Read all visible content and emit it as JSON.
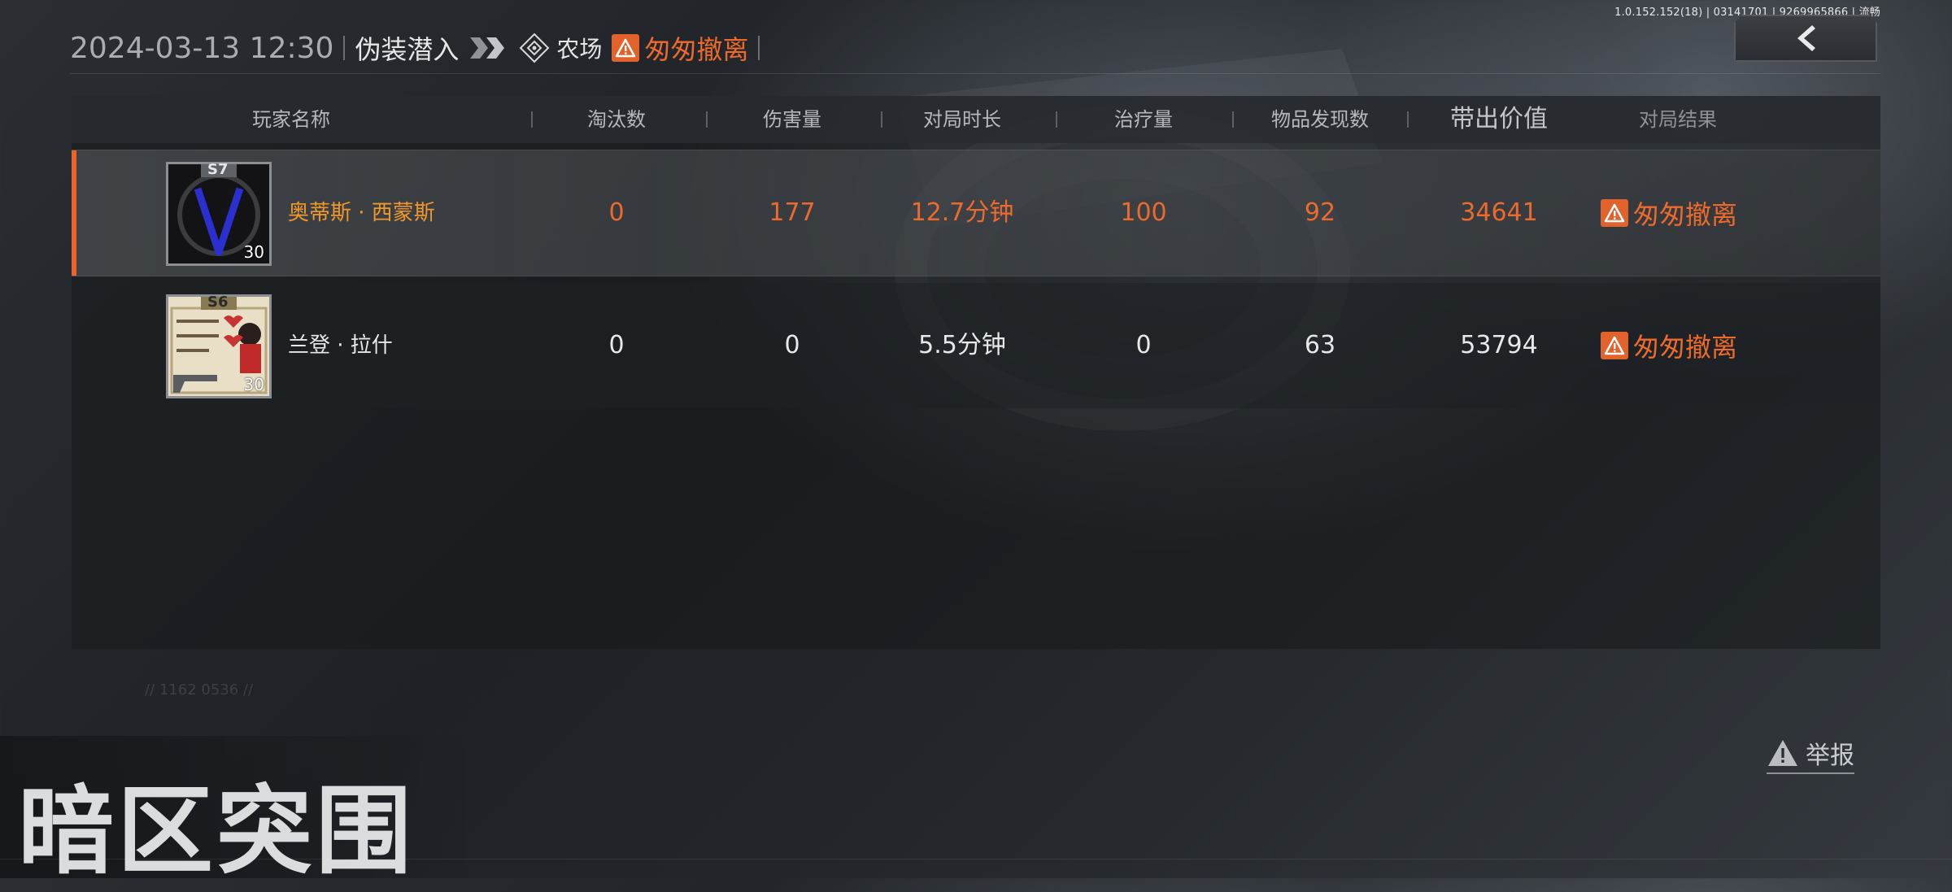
{
  "status_bar": {
    "debug_text": "1.0.152.152(18) | 03141701 | 9269965866 | 流畅"
  },
  "header": {
    "datetime": "2024-03-13 12:30",
    "mode": "伪装潜入",
    "map": "农场",
    "result": "匆匆撤离",
    "back_icon": "chevron-left-icon"
  },
  "table": {
    "columns": [
      "玩家名称",
      "淘汰数",
      "伤害量",
      "对局时长",
      "治疗量",
      "物品发现数",
      "带出价值",
      "对局结果"
    ],
    "rows": [
      {
        "season_badge": "S7",
        "level": "30",
        "name": "奥蒂斯 · 西蒙斯",
        "eliminations": "0",
        "damage": "177",
        "duration": "12.7分钟",
        "healing": "100",
        "items_found": "92",
        "extracted_value": "34641",
        "result": "匆匆撤离",
        "highlight": true
      },
      {
        "season_badge": "S6",
        "level": "30",
        "name": "兰登 · 拉什",
        "eliminations": "0",
        "damage": "0",
        "duration": "5.5分钟",
        "healing": "0",
        "items_found": "63",
        "extracted_value": "53794",
        "result": "匆匆撤离",
        "highlight": false
      }
    ]
  },
  "report_label": "举报",
  "faint_code": "// 1162 0536 //",
  "logo_text": "暗区突围",
  "colors": {
    "accent": "#ec6a2c",
    "name_highlight": "#f0982c",
    "text": "#e6e8ea"
  }
}
